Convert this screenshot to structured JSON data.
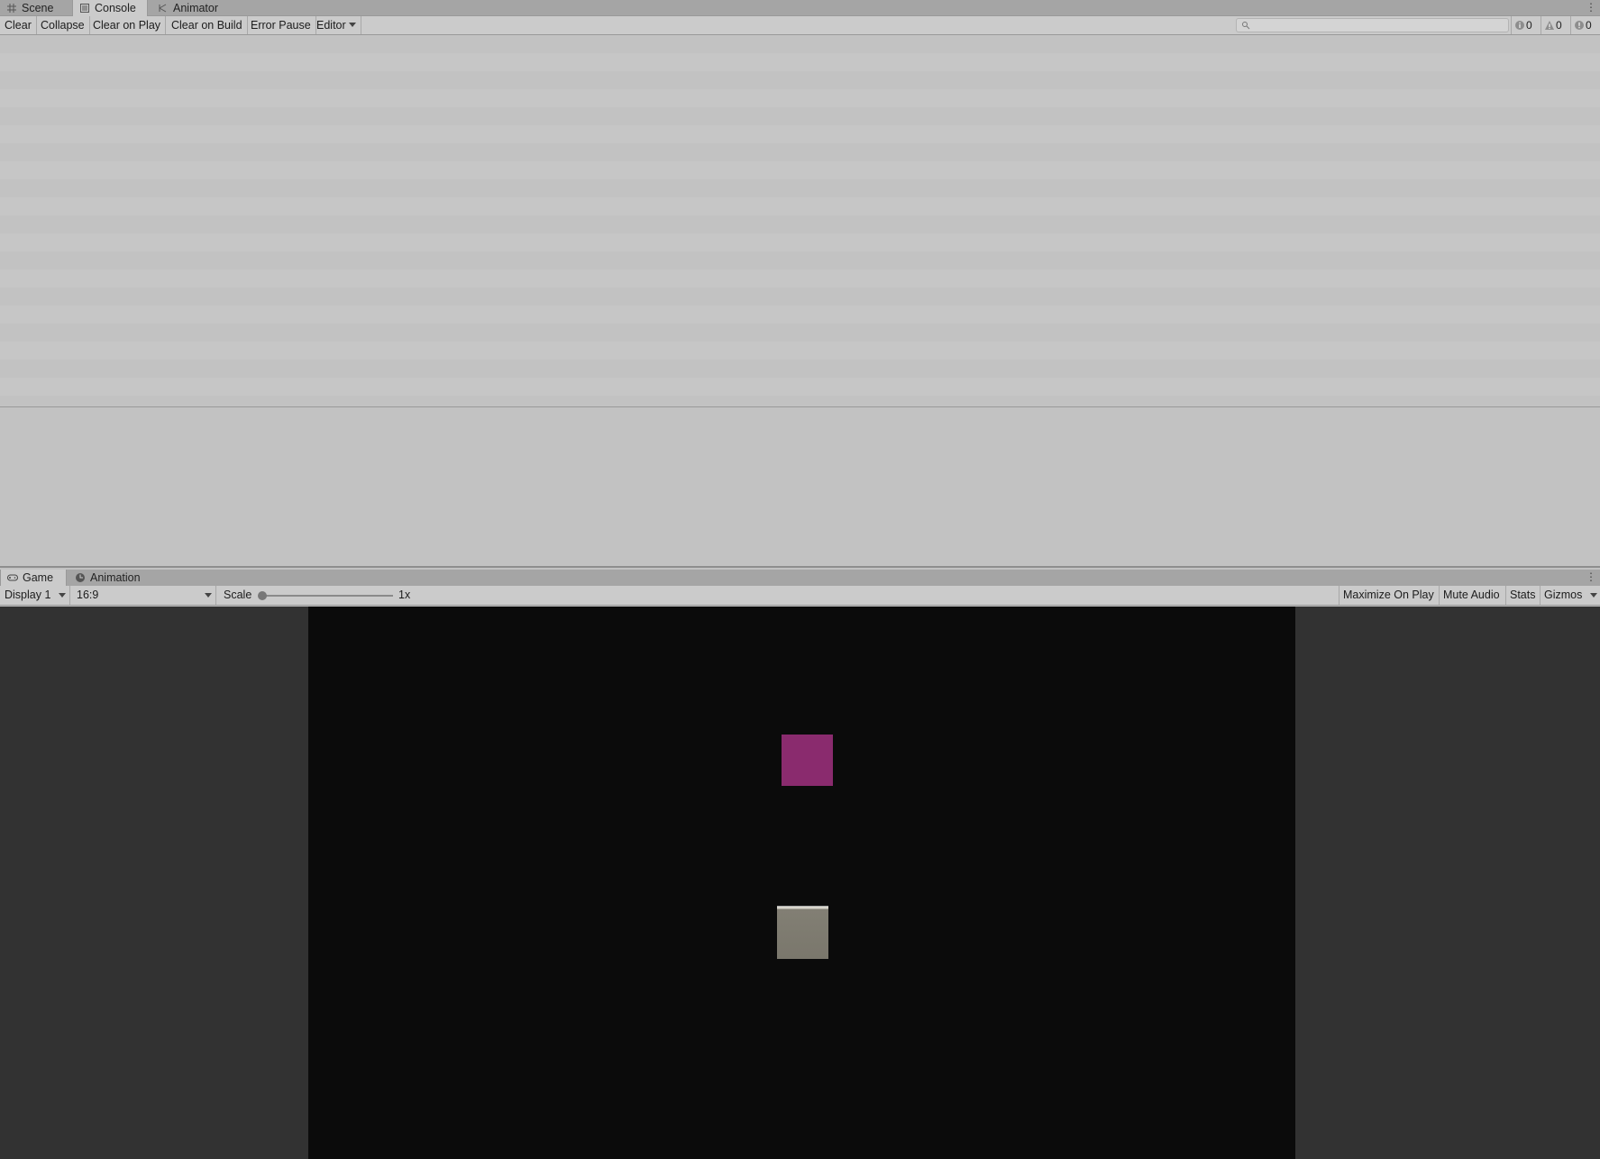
{
  "top_dock": {
    "tabs": [
      {
        "label": "Scene",
        "icon": "grid-icon"
      },
      {
        "label": "Console",
        "icon": "console-icon",
        "active": true
      },
      {
        "label": "Animator",
        "icon": "animator-icon"
      }
    ]
  },
  "console_toolbar": {
    "clear": "Clear",
    "collapse": "Collapse",
    "clear_on_play": "Clear on Play",
    "clear_on_build": "Clear on Build",
    "error_pause": "Error Pause",
    "editor": "Editor",
    "search_placeholder": "",
    "counts": {
      "info": "0",
      "warnings": "0",
      "errors": "0"
    }
  },
  "bottom_dock": {
    "tabs": [
      {
        "label": "Game",
        "icon": "gamepad-icon",
        "active": true
      },
      {
        "label": "Animation",
        "icon": "clock-icon"
      }
    ]
  },
  "game_toolbar": {
    "display": "Display 1",
    "aspect": "16:9",
    "scale_label": "Scale",
    "scale_value": "1x",
    "maximize_on_play": "Maximize On Play",
    "mute_audio": "Mute Audio",
    "stats": "Stats",
    "gizmos": "Gizmos"
  },
  "colors": {
    "game_background": "#0b0b0b",
    "magenta_sprite": "#8a2b6e",
    "stone_sprite": "#7e7b70",
    "editor_panel": "#c2c2c2"
  }
}
